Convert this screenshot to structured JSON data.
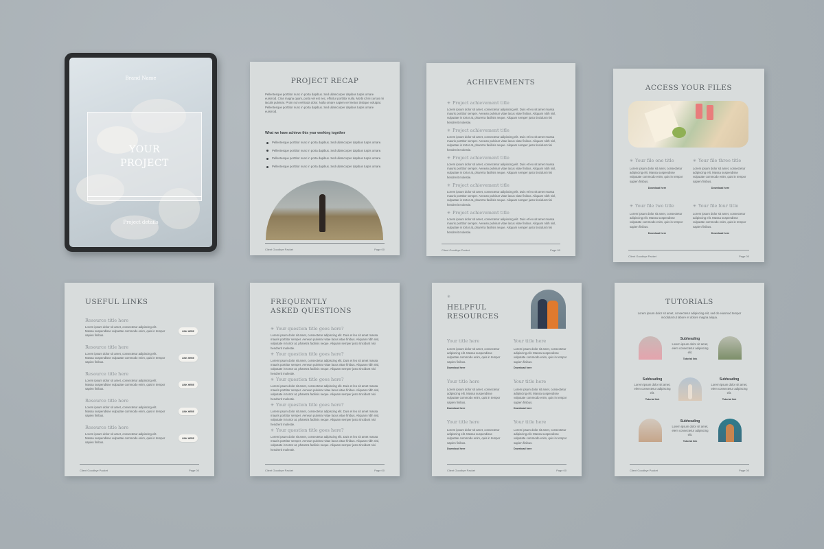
{
  "cover": {
    "brand": "Brand Name",
    "title_line1": "YOUR",
    "title_line2": "PROJECT",
    "details": "Project details"
  },
  "common": {
    "footer_left": "Client Goodbye Packet",
    "footer_right": "Page 00",
    "lorem_long": "Pellentesque porttitor nunc in porta dapibus. Sed ullamcorper dapibus turpis ornare euismod. Cras magna quam, porta vel est nec, efficitur porttitor nulla. Morbi id mi cursus mi iaculis pulvinar. Proin non vehicula dolor. Nulla ornare sapien vel metus tristique volutpat. Pellentesque porttitor nunc in porta dapibus. Sed ullamcorper dapibus turpis ornare euismod.",
    "lorem_short": "Lorem ipsum dolor sit amet, consectetur adipiscing elit. Duis et leo sit amet massa mauris porttitor semper. Aenean pulvinar vitae lacus vitae finibus. Aliquam nibh nisl, vulputate in tortor at, pharetra facilisis neque. Aliquam semper justo tincidunt nisi hendrerit molestie.",
    "lorem_card": "Lorem ipsum dolor sit amet, consectetur adipiscing elit. Massa suspendisse vulputate commodo enim, quis in tempor sapien finibus.",
    "lorem_tiny": "Lorem ipsum dolor sit amet, elem consectetur adipiscing elit."
  },
  "recap": {
    "title": "PROJECT RECAP",
    "subheading": "What we have achieve this year working together",
    "bullets": [
      "Pellentesque porttitor nunc in porta dapibus. Sed ullamcorper dapibus turpis ornare.",
      "Pellentesque porttitor nunc in porta dapibus. Sed ullamcorper dapibus turpis ornare.",
      "Pellentesque porttitor nunc in porta dapibus. Sed ullamcorper dapibus turpis ornare.",
      "Pellentesque porttitor nunc in porta dapibus. Sed ullamcorper dapibus turpis ornare."
    ]
  },
  "achievements": {
    "title": "ACHIEVEMENTS",
    "item_title": "Project achievement title"
  },
  "files": {
    "title": "ACCESS YOUR FILES",
    "items": [
      {
        "title": "Your file one title",
        "link": "Download here"
      },
      {
        "title": "Your file three title",
        "link": "Download here"
      },
      {
        "title": "Your file two title",
        "link": "Download here"
      },
      {
        "title": "Your file four title",
        "link": "Download here"
      }
    ]
  },
  "links": {
    "title": "USEFUL LINKS",
    "item_title": "Resource title here",
    "button": "LINK HERE"
  },
  "faq": {
    "title_line1": "FREQUENTLY",
    "title_line2": "ASKED QUESTIONS",
    "question": "Your question title goes here?"
  },
  "resources": {
    "title_line1": "HELPFUL",
    "title_line2": "RESOURCES",
    "item_title": "Your title here",
    "link": "Download here"
  },
  "tutorials": {
    "title": "TUTORIALS",
    "intro": "Lorem ipsum dolor sit amet, consectetur adipiscing elit, sed do eiusmod tempor incididunt ut labore et dolore magna aliqua.",
    "subheading": "Subheading",
    "link": "Tutorial link"
  }
}
